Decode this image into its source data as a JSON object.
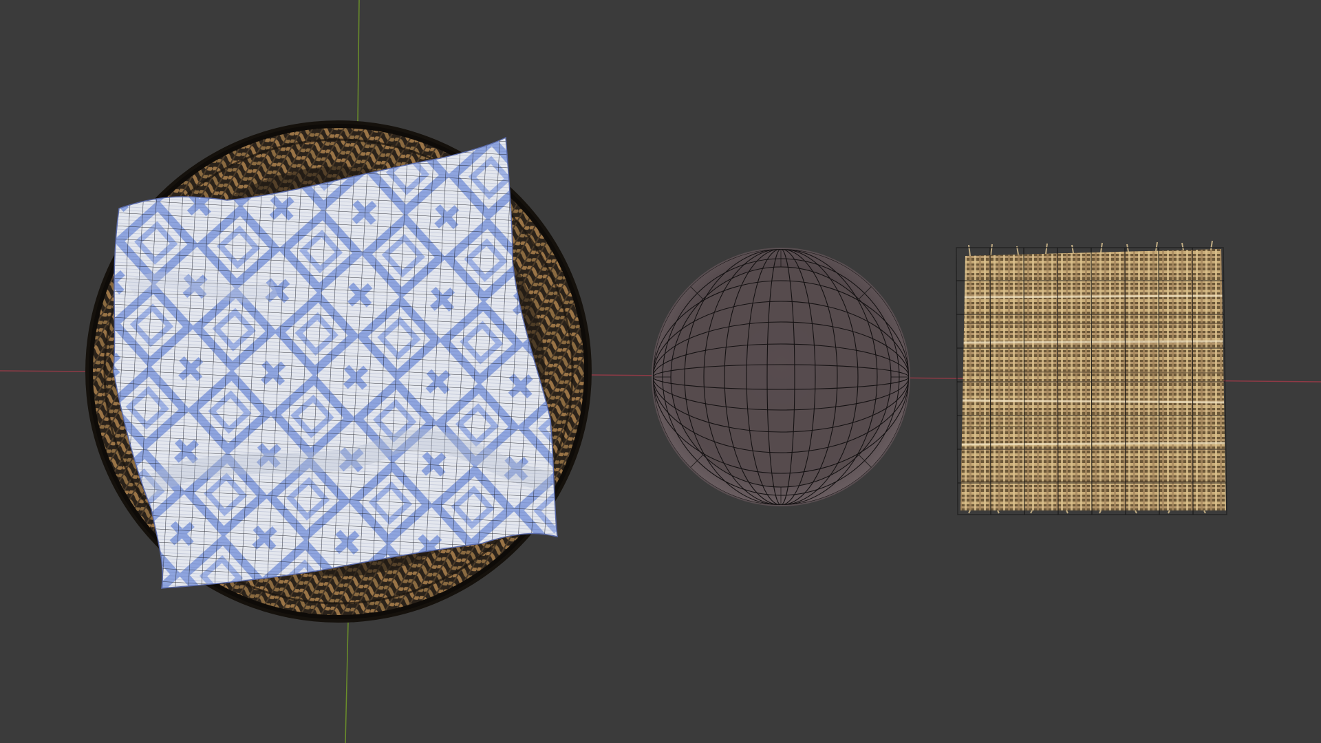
{
  "viewport": {
    "background": "#3b3b3b",
    "axis_x_color": "#8f3a46",
    "axis_y_color": "#6b8f2a",
    "wire_color": "#111111"
  },
  "objects": [
    {
      "name": "wicker-basket",
      "colors": {
        "base": "#2a221a",
        "weave": "#9a7446",
        "weave_dark": "#4a3a28"
      }
    },
    {
      "name": "cloth-napkin",
      "colors": {
        "base": "#e6e9f0",
        "pattern": "#8ea4de"
      }
    },
    {
      "name": "wooden-plate",
      "colors": {
        "base": "#564b4d",
        "rim": "#6e6264",
        "highlight": "#7d7072"
      }
    },
    {
      "name": "burlap-square",
      "colors": {
        "base": "#8a7250",
        "thread_light": "#e8d3a4",
        "thread_dark": "#5a4630"
      }
    }
  ]
}
